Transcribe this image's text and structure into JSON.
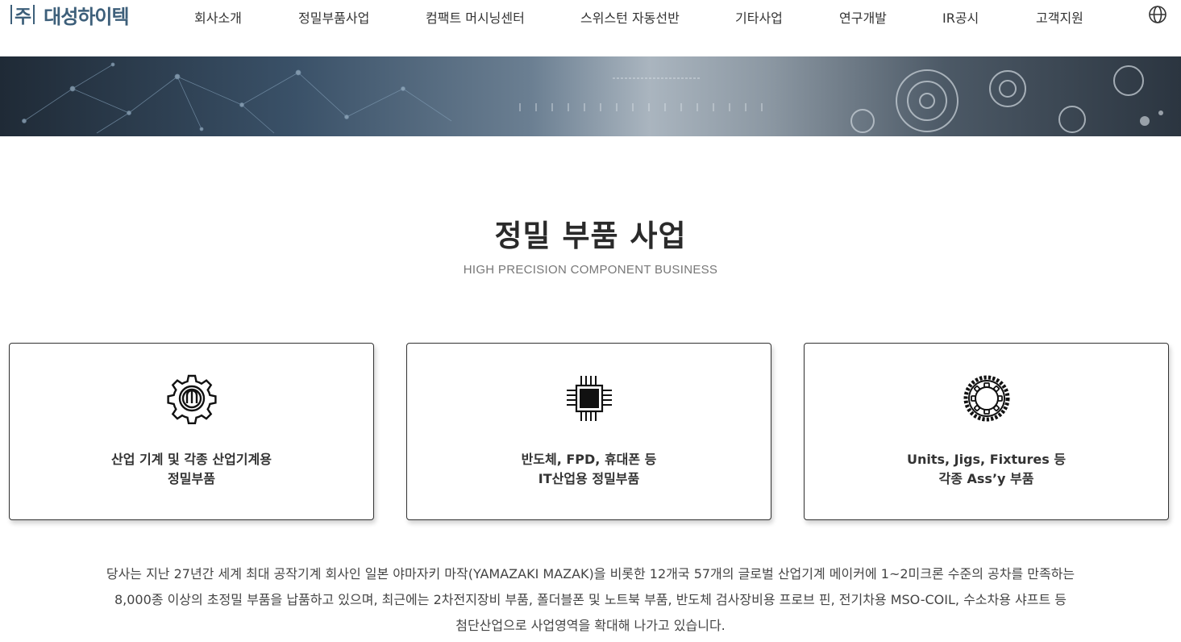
{
  "brand": {
    "ju": "주",
    "name": "대성하이텍"
  },
  "nav": {
    "items": [
      {
        "label": "회사소개"
      },
      {
        "label": "정밀부품사업"
      },
      {
        "label": "컴팩트 머시닝센터"
      },
      {
        "label": "스위스턴 자동선반"
      },
      {
        "label": "기타사업"
      },
      {
        "label": "연구개발"
      },
      {
        "label": "IR공시"
      },
      {
        "label": "고객지원"
      }
    ],
    "globe_icon": "globe-icon"
  },
  "page": {
    "title": "정밀 부품 사업",
    "subtitle": "HIGH PRECISION COMPONENT BUSINESS"
  },
  "cards": [
    {
      "icon": "gear-icon",
      "line1": "산업 기계 및 각종 산업기계용",
      "line2": "정밀부품"
    },
    {
      "icon": "chip-icon",
      "line1": "반도체, FPD, 휴대폰 등",
      "line2": "IT산업용 정밀부품"
    },
    {
      "icon": "sprocket-icon",
      "line1": "Units, Jigs, Fixtures 등",
      "line2": "각종 Ass’y 부품"
    }
  ],
  "description": {
    "line1": "당사는 지난 27년간 세계 최대 공작기계 회사인 일본 야마자키 마작(YAMAZAKI MAZAK)을 비롯한 12개국 57개의 글로벌 산업기계 메이커에 1~2미크론 수준의 공차를 만족하는",
    "line2": "8,000종 이상의 초정밀 부품을 납품하고 있으며, 최근에는 2차전지장비 부품, 폴더블폰 및 노트북 부품, 반도체 검사장비용 프로브 핀, 전기차용 MSO-COIL, 수소차용 샤프트 등",
    "line3": "첨단산업으로 사업영역을 확대해 나가고 있습니다."
  },
  "colors": {
    "brand": "#3d5f7a",
    "card_border": "#333333"
  }
}
